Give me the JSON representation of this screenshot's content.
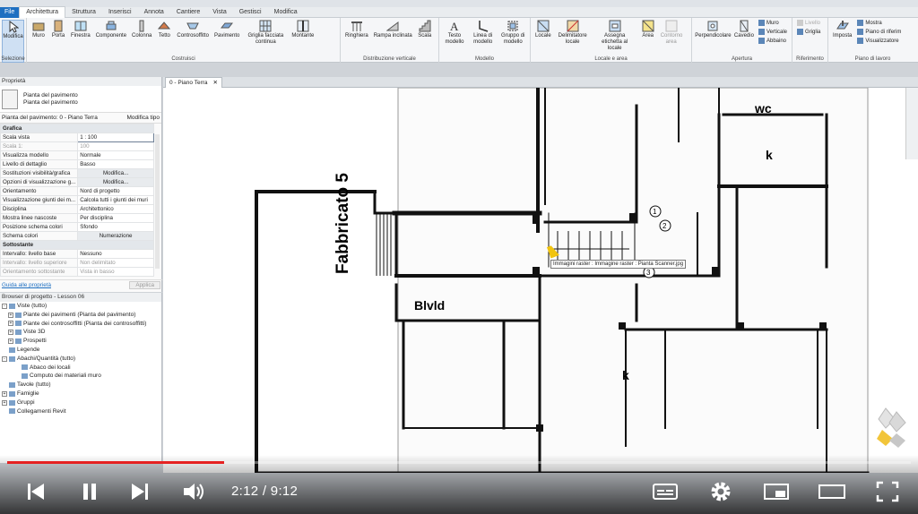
{
  "ribbon": {
    "file_tab": "File",
    "tabs": [
      "Architettura",
      "Struttura",
      "Inserisci",
      "Annota",
      "Cantiere",
      "Vista",
      "Gestisci",
      "Modifica"
    ],
    "active_tab": "Architettura",
    "modify": {
      "tool": "Modifica",
      "sub": "Selezione"
    },
    "costruisci": {
      "label": "Costruisci",
      "tools": [
        "Muro",
        "Porta",
        "Finestra",
        "Componente",
        "Colonna",
        "Tetto",
        "Controsoffitto",
        "Pavimento",
        "Griglia facciata continua",
        "Montante"
      ]
    },
    "distribuzione": {
      "label": "Distribuzione verticale",
      "tools": [
        "Ringhiera",
        "Rampa inclinata",
        "Scala"
      ]
    },
    "modello": {
      "label": "Modello",
      "tools": [
        "Testo modello",
        "Linea di modello",
        "Gruppo di modello"
      ]
    },
    "locale": {
      "label": "Locale e area",
      "tools": [
        "Locale",
        "Delimitatore locale",
        "Assegna etichetta al locale",
        "Area",
        "Contorno area"
      ]
    },
    "apertura": {
      "label": "Apertura",
      "tools": [
        "Perpendicolare",
        "Cavedio"
      ],
      "small": [
        "Muro",
        "Verticale",
        "Abbaino"
      ]
    },
    "riferimento": {
      "label": "Riferimento",
      "small": [
        "Livello",
        "Griglia"
      ]
    },
    "piano": {
      "label": "Piano di lavoro",
      "tools": [
        "Imposta"
      ],
      "small": [
        "Mostra",
        "Piano di riferim",
        "Visualizzatore"
      ]
    }
  },
  "properties": {
    "title": "Proprietà",
    "type_line1": "Pianta del pavimento",
    "type_line2": "Pianta del pavimento",
    "selector": "Pianta del pavimento: 0 - Piano Terra",
    "edit_type": "Modifica tipo",
    "rows": [
      {
        "group": "Grafica"
      },
      {
        "k": "Scala vista",
        "v": "1 : 100",
        "style": "num"
      },
      {
        "k": "Scala 1:",
        "v": "100",
        "style": "dim"
      },
      {
        "k": "Visualizza modello",
        "v": "Normale"
      },
      {
        "k": "Livello di dettaglio",
        "v": "Basso"
      },
      {
        "k": "Sostituzioni visibilità/grafica",
        "v": "Modifica...",
        "style": "btn"
      },
      {
        "k": "Opzioni di visualizzazione g...",
        "v": "Modifica...",
        "style": "btn"
      },
      {
        "k": "Orientamento",
        "v": "Nord di progetto"
      },
      {
        "k": "Visualizzazione giunti dei m...",
        "v": "Calcola tutti i giunti dei muri"
      },
      {
        "k": "Disciplina",
        "v": "Architettonico"
      },
      {
        "k": "Mostra linee nascoste",
        "v": "Per disciplina"
      },
      {
        "k": "Posizione schema colori",
        "v": "Sfondo"
      },
      {
        "k": "Schema colori",
        "v": "Numerazione",
        "style": "btn"
      },
      {
        "group": "Sottostante"
      },
      {
        "k": "Intervallo: livello base",
        "v": "Nessuno"
      },
      {
        "k": "Intervallo: livello superiore",
        "v": "Non delimitato",
        "style": "dim"
      },
      {
        "k": "Orientamento sottostante",
        "v": "Vista in basso",
        "style": "dim"
      }
    ],
    "help_link": "Guida alle proprietà",
    "apply": "Applica"
  },
  "browser": {
    "title": "Browser di progetto - Lesson 06",
    "items": [
      {
        "label": "Viste (tutto)",
        "lvl": 0,
        "exp": "-"
      },
      {
        "label": "Piante dei pavimenti (Pianta del pavimento)",
        "lvl": 1,
        "exp": "+"
      },
      {
        "label": "Piante dei controsoffitti (Pianta dei controsoffitti)",
        "lvl": 1,
        "exp": "+"
      },
      {
        "label": "Viste 3D",
        "lvl": 1,
        "exp": "+"
      },
      {
        "label": "Prospetti",
        "lvl": 1,
        "exp": "+"
      },
      {
        "label": "Legende",
        "lvl": 0,
        "exp": ""
      },
      {
        "label": "Abachi/Quantità (tutto)",
        "lvl": 0,
        "exp": "-"
      },
      {
        "label": "Abaco dei locali",
        "lvl": 2,
        "exp": ""
      },
      {
        "label": "Computo dei materiali muro",
        "lvl": 2,
        "exp": ""
      },
      {
        "label": "Tavole (tutto)",
        "lvl": 0,
        "exp": ""
      },
      {
        "label": "Famiglie",
        "lvl": 0,
        "exp": "+"
      },
      {
        "label": "Gruppi",
        "lvl": 0,
        "exp": "+"
      },
      {
        "label": "Collegamenti Revit",
        "lvl": 0,
        "exp": ""
      }
    ]
  },
  "view": {
    "tab_label": "0 - Piano Terra",
    "close": "✕",
    "drawing_labels": {
      "building": "Fabbricato 5",
      "wc": "wc",
      "k1": "k",
      "k2": "k",
      "blvd": "Blvld",
      "n1": "1",
      "n2": "2",
      "n3": "3"
    },
    "tooltip": "Immagini raster : Immagine raster : Pianta Scanner.jpg"
  },
  "video": {
    "current": "2:12",
    "duration": "9:12",
    "time_display": "2:12 / 9:12",
    "progress": 0.24
  }
}
